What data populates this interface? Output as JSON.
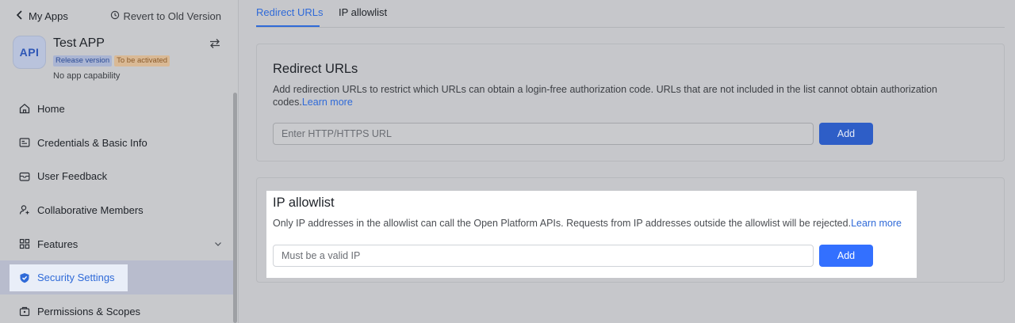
{
  "topbar": {
    "back_label": "My Apps",
    "revert_label": "Revert to Old Version"
  },
  "app": {
    "logo_text": "API",
    "name": "Test APP",
    "badge_release": "Release version",
    "badge_status": "To be activated",
    "capability": "No app capability"
  },
  "nav": {
    "items": [
      {
        "label": "Home",
        "icon": "home-icon"
      },
      {
        "label": "Credentials & Basic Info",
        "icon": "credentials-icon"
      },
      {
        "label": "User Feedback",
        "icon": "feedback-icon"
      },
      {
        "label": "Collaborative Members",
        "icon": "add-member-icon"
      },
      {
        "label": "Features",
        "icon": "features-grid-icon"
      },
      {
        "label": "Security Settings",
        "icon": "shield-icon",
        "active": true
      },
      {
        "label": "Permissions & Scopes",
        "icon": "permissions-icon"
      }
    ]
  },
  "tabs": [
    {
      "label": "Redirect URLs",
      "active": true
    },
    {
      "label": "IP allowlist",
      "active": false
    }
  ],
  "redirect": {
    "title": "Redirect URLs",
    "description": "Add redirection URLs to restrict which URLs can obtain a login-free authorization code. URLs that are not included in the list cannot obtain authorization codes.",
    "learn_more": "Learn more",
    "placeholder": "Enter HTTP/HTTPS URL",
    "add_label": "Add"
  },
  "ip": {
    "title": "IP allowlist",
    "description": "Only IP addresses in the allowlist can call the Open Platform APIs. Requests from IP addresses outside the allowlist will be rejected.",
    "learn_more": "Learn more",
    "placeholder": "Must be a valid IP",
    "add_label": "Add"
  },
  "colors": {
    "accent": "#3370ff",
    "link": "#2f6ad8"
  }
}
